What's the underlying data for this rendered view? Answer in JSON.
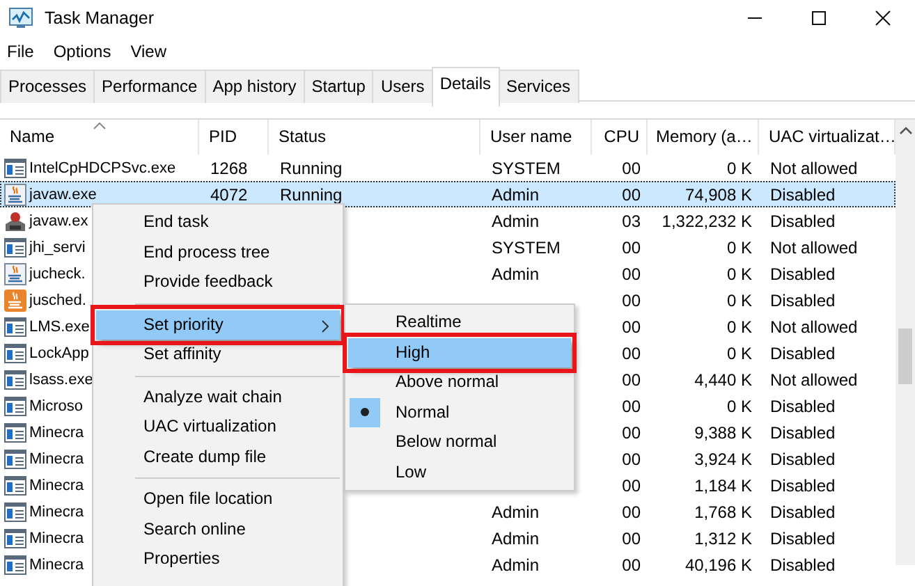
{
  "window": {
    "title": "Task Manager"
  },
  "menu_bar": [
    "File",
    "Options",
    "View"
  ],
  "tabs": [
    {
      "label": "Processes",
      "selected": false
    },
    {
      "label": "Performance",
      "selected": false
    },
    {
      "label": "App history",
      "selected": false
    },
    {
      "label": "Startup",
      "selected": false
    },
    {
      "label": "Users",
      "selected": false
    },
    {
      "label": "Details",
      "selected": true
    },
    {
      "label": "Services",
      "selected": false
    }
  ],
  "table": {
    "columns": [
      "Name",
      "PID",
      "Status",
      "User name",
      "CPU",
      "Memory (a…",
      "UAC virtualizat…"
    ],
    "rows": [
      {
        "kind": "window",
        "name": "IntelCpHDCPSvc.exe",
        "pid": "1268",
        "status": "Running",
        "user": "SYSTEM",
        "cpu": "00",
        "memory": "0 K",
        "uac": "Not allowed",
        "selected": false
      },
      {
        "kind": "java",
        "name": "javaw.exe",
        "pid": "4072",
        "status": "Running",
        "user": "Admin",
        "cpu": "00",
        "memory": "74,908 K",
        "uac": "Disabled",
        "selected": true
      },
      {
        "kind": "game",
        "name": "javaw.ex",
        "user": "Admin",
        "cpu": "03",
        "memory": "1,322,232 K",
        "uac": "Disabled",
        "selected": false
      },
      {
        "kind": "window",
        "name": "jhi_servi",
        "user": "SYSTEM",
        "cpu": "00",
        "memory": "0 K",
        "uac": "Not allowed",
        "selected": false
      },
      {
        "kind": "java",
        "name": "jucheck.",
        "user": "Admin",
        "cpu": "00",
        "memory": "0 K",
        "uac": "Disabled",
        "selected": false
      },
      {
        "kind": "update",
        "name": "jusched.",
        "cpu": "00",
        "memory": "0 K",
        "uac": "Disabled",
        "selected": false
      },
      {
        "kind": "window",
        "name": "LMS.exe",
        "cpu": "00",
        "memory": "0 K",
        "uac": "Not allowed",
        "selected": false
      },
      {
        "kind": "window",
        "name": "LockApp",
        "cpu": "00",
        "memory": "0 K",
        "uac": "Disabled",
        "selected": false
      },
      {
        "kind": "window",
        "name": "lsass.exe",
        "cpu": "00",
        "memory": "4,440 K",
        "uac": "Not allowed",
        "selected": false
      },
      {
        "kind": "window",
        "name": "Microso",
        "cpu": "00",
        "memory": "0 K",
        "uac": "Disabled",
        "selected": false
      },
      {
        "kind": "window",
        "name": "Minecra",
        "cpu": "00",
        "memory": "9,388 K",
        "uac": "Disabled",
        "selected": false
      },
      {
        "kind": "window",
        "name": "Minecra",
        "cpu": "00",
        "memory": "3,924 K",
        "uac": "Disabled",
        "selected": false
      },
      {
        "kind": "window",
        "name": "Minecra",
        "cpu": "00",
        "memory": "1,184 K",
        "uac": "Disabled",
        "selected": false
      },
      {
        "kind": "window",
        "name": "Minecra",
        "user": "Admin",
        "cpu": "00",
        "memory": "1,768 K",
        "uac": "Disabled",
        "selected": false
      },
      {
        "kind": "window",
        "name": "Minecra",
        "user": "Admin",
        "cpu": "00",
        "memory": "1,312 K",
        "uac": "Disabled",
        "selected": false
      },
      {
        "kind": "window",
        "name": "Minecra",
        "user": "Admin",
        "cpu": "00",
        "memory": "40,196 K",
        "uac": "Disabled",
        "selected": false
      }
    ]
  },
  "context_menu": {
    "groups": [
      [
        {
          "label": "End task",
          "highlighted": false,
          "outlined": false,
          "submenu": false
        },
        {
          "label": "End process tree",
          "highlighted": false,
          "outlined": false,
          "submenu": false
        },
        {
          "label": "Provide feedback",
          "highlighted": false,
          "outlined": false,
          "submenu": false
        }
      ],
      [
        {
          "label": "Set priority",
          "highlighted": true,
          "outlined": true,
          "submenu": true
        },
        {
          "label": "Set affinity",
          "highlighted": false,
          "outlined": false,
          "submenu": false
        }
      ],
      [
        {
          "label": "Analyze wait chain",
          "highlighted": false,
          "outlined": false,
          "submenu": false
        },
        {
          "label": "UAC virtualization",
          "highlighted": false,
          "outlined": false,
          "submenu": false
        },
        {
          "label": "Create dump file",
          "highlighted": false,
          "outlined": false,
          "submenu": false
        }
      ],
      [
        {
          "label": "Open file location",
          "highlighted": false,
          "outlined": false,
          "submenu": false
        },
        {
          "label": "Search online",
          "highlighted": false,
          "outlined": false,
          "submenu": false
        },
        {
          "label": "Properties",
          "highlighted": false,
          "outlined": false,
          "submenu": false
        }
      ]
    ]
  },
  "priority_submenu": {
    "items": [
      {
        "label": "Realtime",
        "highlighted": false,
        "outlined": false,
        "checked": false
      },
      {
        "label": "High",
        "highlighted": true,
        "outlined": true,
        "checked": false
      },
      {
        "label": "Above normal",
        "highlighted": false,
        "outlined": false,
        "checked": false
      },
      {
        "label": "Normal",
        "highlighted": false,
        "outlined": false,
        "checked": true
      },
      {
        "label": "Below normal",
        "highlighted": false,
        "outlined": false,
        "checked": false
      },
      {
        "label": "Low",
        "highlighted": false,
        "outlined": false,
        "checked": false
      }
    ]
  }
}
